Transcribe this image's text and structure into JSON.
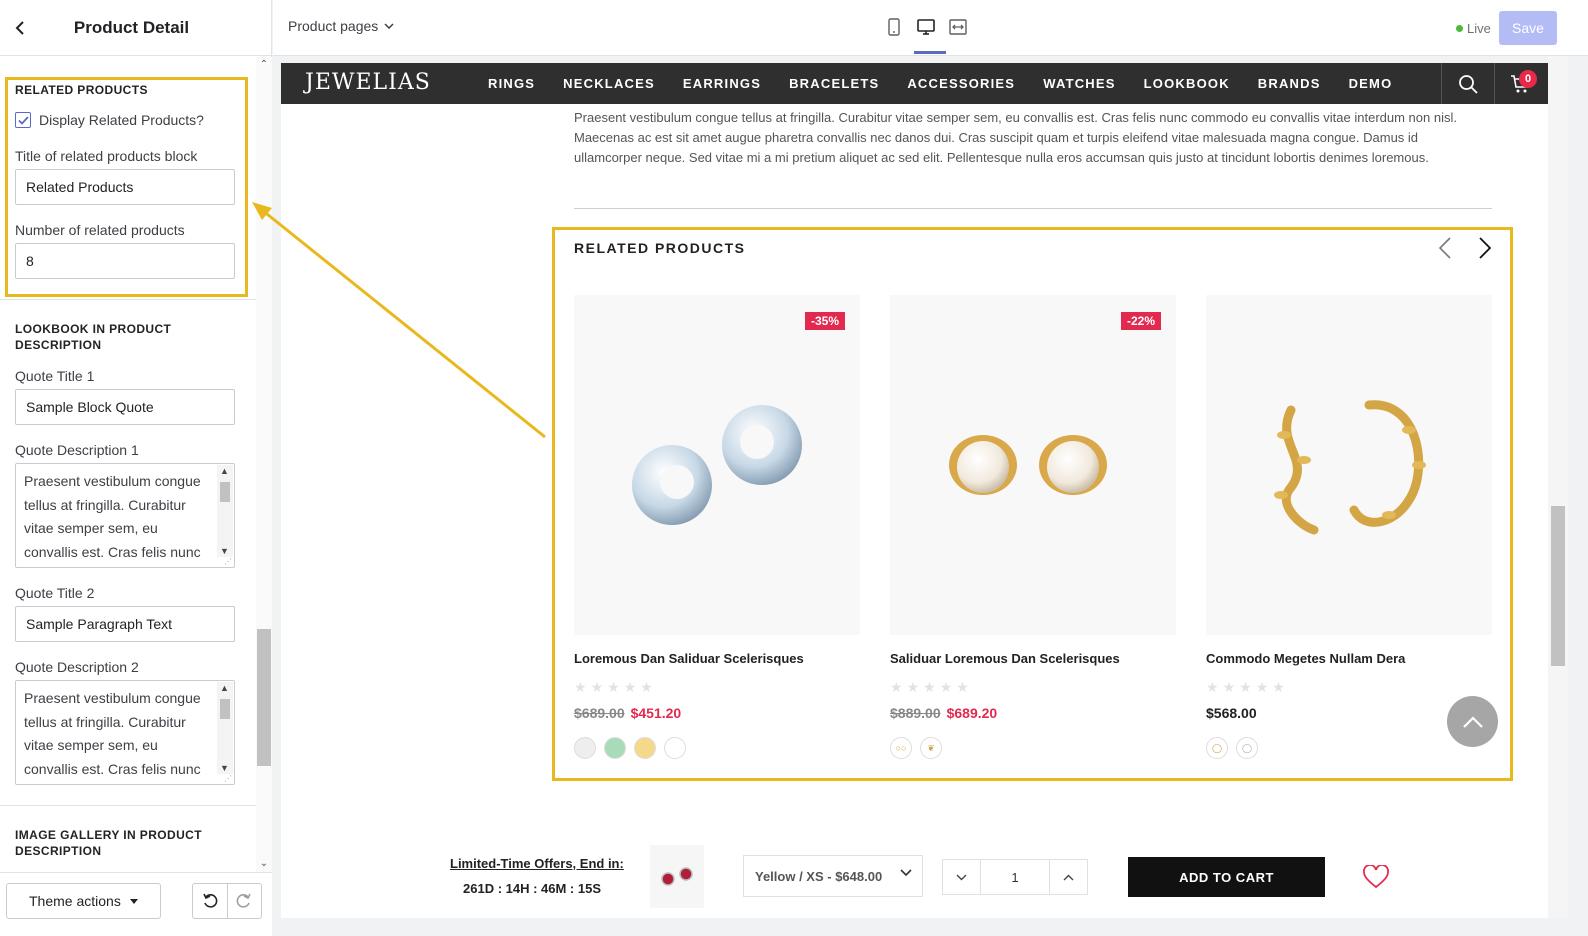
{
  "sidebar": {
    "title": "Product Detail",
    "related": {
      "section_title": "RELATED PRODUCTS",
      "display_label": "Display Related Products?",
      "display_checked": true,
      "block_title_label": "Title of related products block",
      "block_title_value": "Related Products",
      "count_label": "Number of related products",
      "count_value": "8"
    },
    "lookbook": {
      "section_title": "LOOKBOOK IN PRODUCT DESCRIPTION",
      "quote_title_1_label": "Quote Title 1",
      "quote_title_1_value": "Sample Block Quote",
      "quote_desc_1_label": "Quote Description 1",
      "quote_desc_1_value": "Praesent vestibulum congue tellus at fringilla. Curabitur vitae semper sem, eu convallis est. Cras felis nunc commodo",
      "quote_title_2_label": "Quote Title 2",
      "quote_title_2_value": "Sample Paragraph Text",
      "quote_desc_2_label": "Quote Description 2",
      "quote_desc_2_value": "Praesent vestibulum congue tellus at fringilla. Curabitur vitae semper sem, eu convallis est. Cras felis nunc commodo"
    },
    "gallery": {
      "section_title": "IMAGE GALLERY IN PRODUCT DESCRIPTION"
    },
    "footer": {
      "theme_actions": "Theme actions"
    }
  },
  "topbar": {
    "page_select": "Product pages",
    "live_label": "Live",
    "save_label": "Save"
  },
  "store": {
    "logo": "JEWELIAS",
    "nav": [
      "RINGS",
      "NECKLACES",
      "EARRINGS",
      "BRACELETS",
      "ACCESSORIES",
      "WATCHES",
      "LOOKBOOK",
      "BRANDS",
      "DEMO"
    ],
    "cart_count": "0",
    "description": "Praesent vestibulum congue tellus at fringilla. Curabitur vitae semper sem, eu convallis est. Cras felis nunc commodo eu convallis vitae interdum non nisl. Maecenas ac est sit amet augue pharetra convallis nec danos dui. Cras suscipit quam et turpis eleifend vitae malesuada magna congue. Damus id ullamcorper neque. Sed vitae mi a mi pretium aliquet ac sed elit. Pellentesque nulla eros accumsan quis justo at tincidunt lobortis denimes loremous.",
    "related_title": "RELATED PRODUCTS",
    "products": [
      {
        "name": "Loremous Dan Saliduar Scelerisques",
        "badge": "-35%",
        "old_price": "$689.00",
        "price": "$451.20",
        "rating": 0,
        "swatches": [
          "#eeeeee",
          "#a8dcb9",
          "#f4d98a",
          "#ffffff"
        ]
      },
      {
        "name": "Saliduar Loremous Dan Scelerisques",
        "badge": "-22%",
        "old_price": "$889.00",
        "price": "$689.20",
        "rating": 0,
        "swatches": [
          "thumb-pearl",
          "thumb-leaf"
        ]
      },
      {
        "name": "Commodo Megetes Nullam Dera",
        "badge": "",
        "old_price": "",
        "price": "$568.00",
        "rating": 0,
        "swatches": [
          "thumb-gold-hoop",
          "thumb-silver-hoop"
        ]
      }
    ],
    "sticky": {
      "offer_label": "Limited-Time Offers, End in:",
      "timer": "261D : 14H : 46M : 15S",
      "variant": "Yellow / XS - $648.00",
      "quantity": "1",
      "add_to_cart": "ADD TO CART"
    }
  },
  "colors": {
    "highlight": "#e9b81f",
    "sale": "#e2294f",
    "nav_bg": "#2f2f2f",
    "accent": "#5c6ac4"
  }
}
